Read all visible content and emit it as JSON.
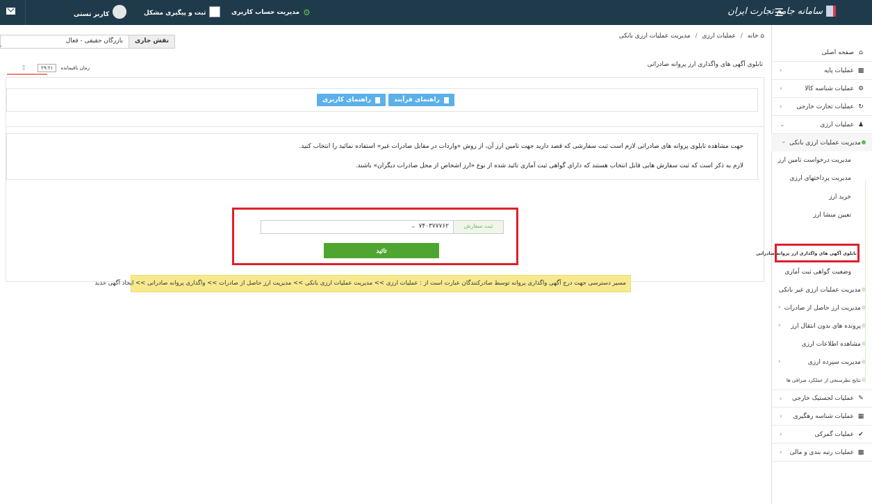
{
  "topbar": {
    "logo": "سامانه جامع تجارت ایران",
    "menu_icon": "menu-icon",
    "account_label": "مدیریت حساب کاربری",
    "track_label": "ثبت و پیگیری مشکل",
    "user_name": "کاربر تستی",
    "mail_icon": "mail-icon"
  },
  "breadcrumb": {
    "home": "خانه",
    "level1": "عملیات ارزی",
    "level2": "مدیریت عملیات ارزی بانکی"
  },
  "role": {
    "label": "نقش جاری",
    "value": "بازرگان حقیقی - فعال"
  },
  "page": {
    "title": "تابلوی آگهی های واگذاری ارز پروانه صادراتی",
    "timer_label": "زمان باقیمانده",
    "timer_value": "۲۹:۲۱"
  },
  "guides": {
    "process_guide": "راهنمای فرآیند",
    "user_guide": "راهنمای کاربری"
  },
  "info": {
    "line1": "جهت مشاهده تابلوی پروانه های صادراتی لازم است ثبت سفارشی که قصد دارید جهت تامین ارز آن، از روش «واردات در مقابل صادرات غیر» استفاده نمائید را انتخاب کنید.",
    "line2": "لازم به ذکر است که ثبت سفارش هایی قابل انتخاب هستند که دارای گواهی ثبت آماری تائید شده از نوع «ارز اشخاص از محل صادرات دیگران» باشند."
  },
  "form": {
    "select_label": "ثبت سفارش",
    "select_value": "۷۴۰۳۷۷۷۶۲",
    "confirm_label": "تائید"
  },
  "warning": "مسیر دسترسی جهت درج آگهی واگذاری پروانه توسط صادرکنندگان عبارت است از : عملیات ارزی >> مدیریت عملیات ارزی بانکی >> مدیریت ارز حاصل از صادرات >> واگذاری پروانه صادراتی >> ایجاد آگهی جدید",
  "sidebar": {
    "items": [
      {
        "label": "صفحه اصلی",
        "icon": "home-icon"
      },
      {
        "label": "عملیات پایه",
        "icon": "chart-icon"
      },
      {
        "label": "عملیات شناسه کالا",
        "icon": "cogs-icon"
      },
      {
        "label": "عملیات تجارت خارجی",
        "icon": "refresh-icon"
      },
      {
        "label": "عملیات ارزی",
        "icon": "users-icon"
      }
    ],
    "sub_active": "مدیریت عملیات ارزی بانکی",
    "subsub": [
      "مدیریت درخواست تامین ارز",
      "مدیریت پرداختهای ارزی",
      "خرید ارز",
      "تعیین منشا ارز",
      "تابلوی آگهی های واگذاری ارز پروانه صادراتی",
      "وضعیت گواهی ثبت آماری"
    ],
    "sub_rest": [
      "مدیریت عملیات ارزی غیر بانکی",
      "مدیریت ارز حاصل از صادرات",
      "پرونده های بدون انتقال ارز",
      "مشاهده اطلاعات ارزی",
      "مدیریت سپرده ارزی",
      "نتایج نظرسنجی از عملکرد صرافی ها"
    ],
    "bottom": [
      {
        "label": "عملیات لجستیک خارجی",
        "icon": "edit-icon"
      },
      {
        "label": "عملیات شناسه رهگیری",
        "icon": "barcode-icon"
      },
      {
        "label": "عملیات گمرکی",
        "icon": "check-icon"
      },
      {
        "label": "عملیات رتبه بندی و مالی",
        "icon": "chart-icon"
      }
    ]
  }
}
